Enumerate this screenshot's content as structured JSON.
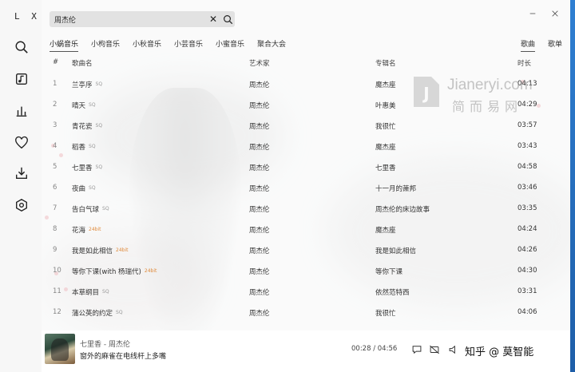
{
  "app": {
    "brand": "L X"
  },
  "search": {
    "value": "周杰伦",
    "placeholder": ""
  },
  "sources": [
    {
      "label": "小蜗音乐",
      "active": true
    },
    {
      "label": "小枸音乐",
      "active": false
    },
    {
      "label": "小秋音乐",
      "active": false
    },
    {
      "label": "小芸音乐",
      "active": false
    },
    {
      "label": "小蜜音乐",
      "active": false
    },
    {
      "label": "聚合大会",
      "active": false
    }
  ],
  "right_tabs": [
    {
      "label": "歌曲",
      "active": true
    },
    {
      "label": "歌单",
      "active": false
    }
  ],
  "columns": {
    "num": "#",
    "name": "歌曲名",
    "artist": "艺术家",
    "album": "专辑名",
    "duration": "时长"
  },
  "songs": [
    {
      "num": "1",
      "name": "兰亭序",
      "quality": "SQ",
      "artist": "周杰伦",
      "album": "魔杰座",
      "duration": "04:13"
    },
    {
      "num": "2",
      "name": "晴天",
      "quality": "SQ",
      "artist": "周杰伦",
      "album": "叶惠美",
      "duration": "04:29"
    },
    {
      "num": "3",
      "name": "青花瓷",
      "quality": "SQ",
      "artist": "周杰伦",
      "album": "我很忙",
      "duration": "03:57"
    },
    {
      "num": "4",
      "name": "稻香",
      "quality": "SQ",
      "artist": "周杰伦",
      "album": "魔杰座",
      "duration": "03:43"
    },
    {
      "num": "5",
      "name": "七里香",
      "quality": "SQ",
      "artist": "周杰伦",
      "album": "七里香",
      "duration": "04:58"
    },
    {
      "num": "6",
      "name": "夜曲",
      "quality": "SQ",
      "artist": "周杰伦",
      "album": "十一月的萧邦",
      "duration": "03:46"
    },
    {
      "num": "7",
      "name": "告白气球",
      "quality": "SQ",
      "artist": "周杰伦",
      "album": "周杰伦的床边故事",
      "duration": "03:35"
    },
    {
      "num": "8",
      "name": "花海",
      "quality": "24bit",
      "artist": "周杰伦",
      "album": "魔杰座",
      "duration": "04:24"
    },
    {
      "num": "9",
      "name": "我是如此相信",
      "quality": "24bit",
      "artist": "周杰伦",
      "album": "我是如此相信",
      "duration": "04:26"
    },
    {
      "num": "10",
      "name": "等你下课(with 杨瑞代)",
      "quality": "24bit",
      "artist": "周杰伦",
      "album": "等你下课",
      "duration": "04:30"
    },
    {
      "num": "11",
      "name": "本草纲目",
      "quality": "SQ",
      "artist": "周杰伦",
      "album": "依然范特西",
      "duration": "03:31"
    },
    {
      "num": "12",
      "name": "蒲公英的约定",
      "quality": "SQ",
      "artist": "周杰伦",
      "album": "我很忙",
      "duration": "04:06"
    }
  ],
  "player": {
    "title": "七里香 - 周杰伦",
    "lyric": "窗外的麻雀在电线杆上多嘴",
    "time": "00:28 / 04:56",
    "progress": 0.095
  },
  "watermarks": {
    "brand_latin": "Jianeryi.com",
    "brand_cn": "简而易网",
    "zhihu": "知乎 @ 莫智能"
  },
  "colors": {
    "accent_hq": "#e08a3a",
    "text": "#333333",
    "desktop": "#2b6fb8"
  },
  "icons": [
    "search-icon",
    "music-list-icon",
    "chart-icon",
    "heart-icon",
    "download-icon",
    "settings-icon",
    "close-icon",
    "minimize-icon",
    "comment-icon",
    "no-lyric-icon",
    "volume-icon",
    "repeat-icon",
    "playlist-icon",
    "menu-icon"
  ]
}
